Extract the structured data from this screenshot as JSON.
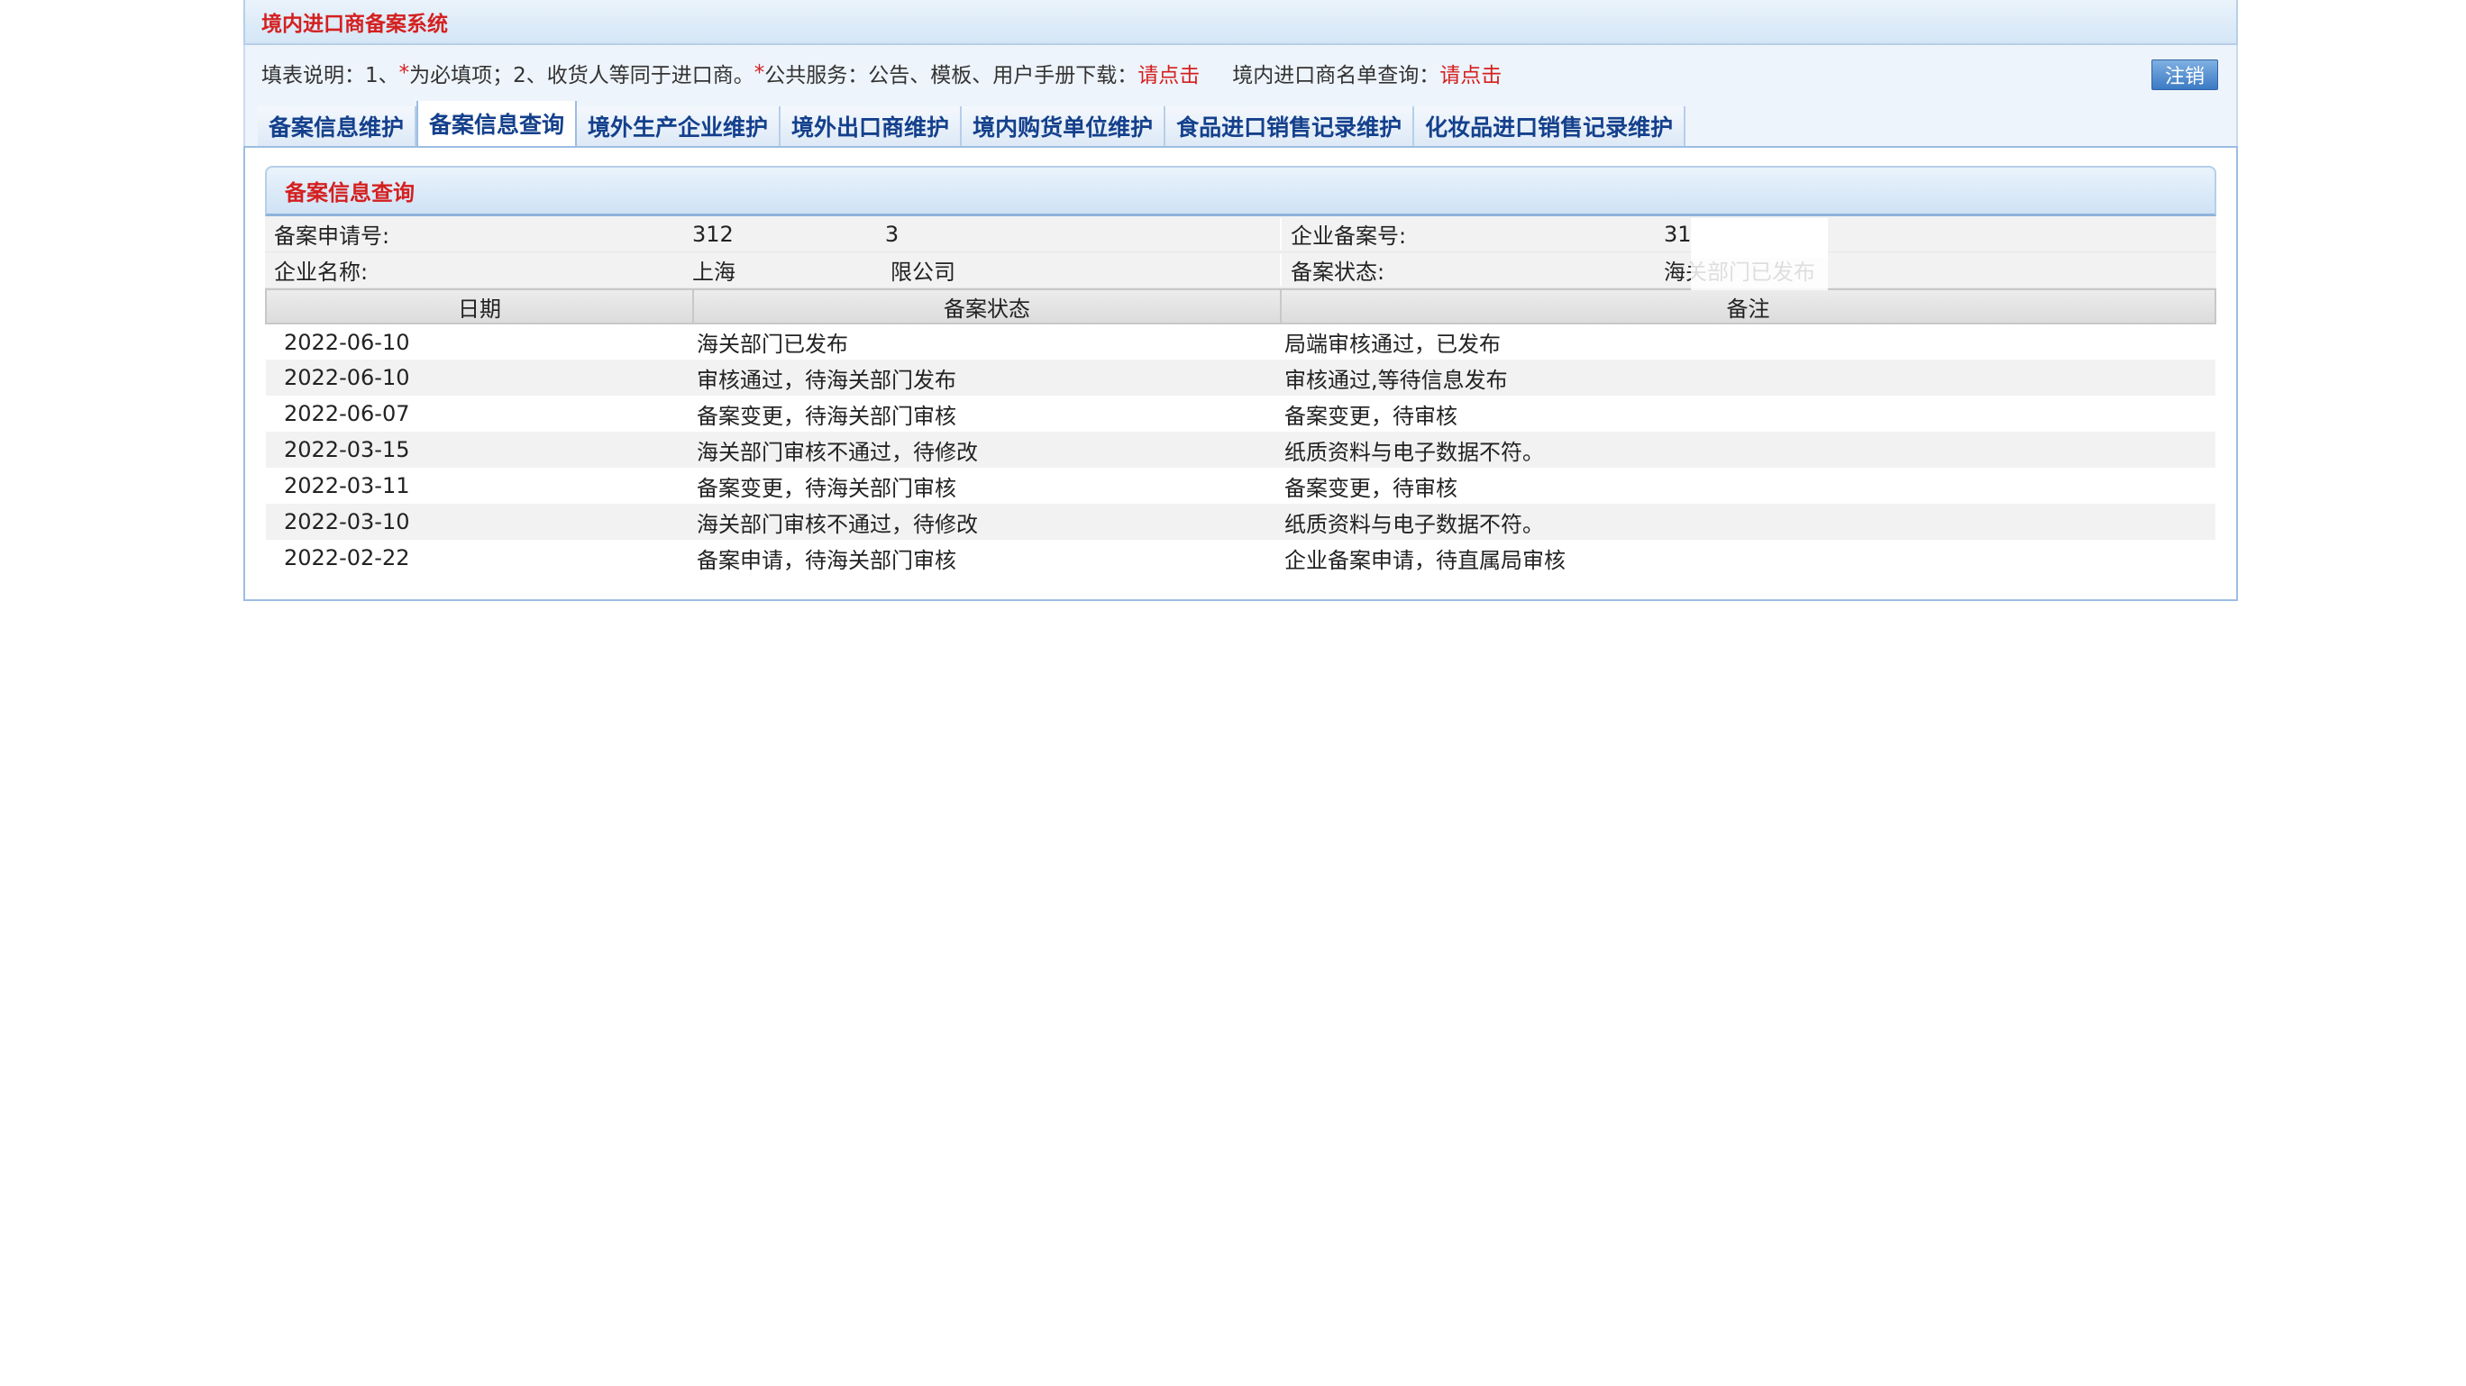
{
  "app_title": "境内进口商备案系统",
  "info": {
    "prefix": "填表说明：1、",
    "star1": "*",
    "text1": " 为必填项；2、收货人等同于进口商。",
    "star2": "*",
    "text2": "公共服务：公告、模板、用户手册下载：",
    "link1": "请点击",
    "text3": "境内进口商名单查询：",
    "link2": "请点击"
  },
  "logout_label": "注销",
  "tabs": [
    {
      "label": "备案信息维护",
      "active": false
    },
    {
      "label": "备案信息查询",
      "active": true
    },
    {
      "label": "境外生产企业维护",
      "active": false
    },
    {
      "label": "境外出口商维护",
      "active": false
    },
    {
      "label": "境内购货单位维护",
      "active": false
    },
    {
      "label": "食品进口销售记录维护",
      "active": false
    },
    {
      "label": "化妆品进口销售记录维护",
      "active": false
    }
  ],
  "section_title": "备案信息查询",
  "summary": {
    "app_no_label": "备案申请号:",
    "app_no_part1": "312",
    "app_no_part2": "3",
    "ent_no_label": "企业备案号:",
    "ent_no_value": "31",
    "name_label": "企业名称:",
    "name_part1": "上海",
    "name_part2": "限公司",
    "status_label": "备案状态:",
    "status_value": "海关部门已发布"
  },
  "history": {
    "headers": [
      "日期",
      "备案状态",
      "备注"
    ],
    "rows": [
      {
        "date": "2022-06-10",
        "status": "海关部门已发布",
        "remark": "局端审核通过，已发布"
      },
      {
        "date": "2022-06-10",
        "status": "审核通过，待海关部门发布",
        "remark": "审核通过,等待信息发布"
      },
      {
        "date": "2022-06-07",
        "status": "备案变更，待海关部门审核",
        "remark": "备案变更，待审核"
      },
      {
        "date": "2022-03-15",
        "status": "海关部门审核不通过，待修改",
        "remark": "纸质资料与电子数据不符。"
      },
      {
        "date": "2022-03-11",
        "status": "备案变更，待海关部门审核",
        "remark": "备案变更，待审核"
      },
      {
        "date": "2022-03-10",
        "status": "海关部门审核不通过，待修改",
        "remark": "纸质资料与电子数据不符。"
      },
      {
        "date": "2022-02-22",
        "status": "备案申请，待海关部门审核",
        "remark": "企业备案申请，待直属局审核"
      }
    ]
  }
}
